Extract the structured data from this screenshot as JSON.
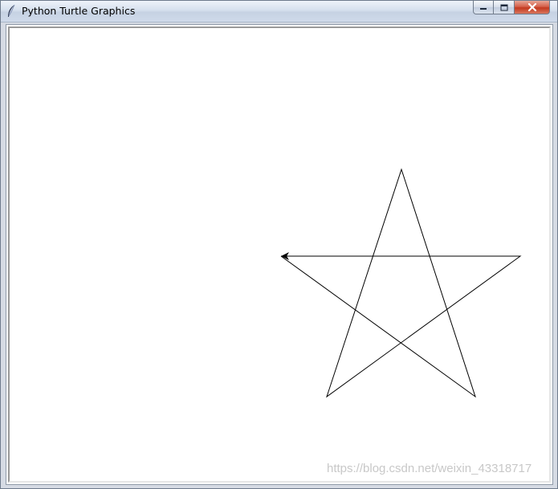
{
  "window": {
    "title": "Python Turtle Graphics",
    "controls": {
      "minimize_icon": "minimize-icon",
      "maximize_icon": "maximize-icon",
      "close_icon": "close-icon"
    }
  },
  "canvas": {
    "background": "#ffffff",
    "pen_color": "#000000",
    "drawing": "five-pointed star",
    "turtle": {
      "shape": "classic",
      "heading_deg": 180
    }
  },
  "watermark": "https://blog.csdn.net/weixin_43318717"
}
